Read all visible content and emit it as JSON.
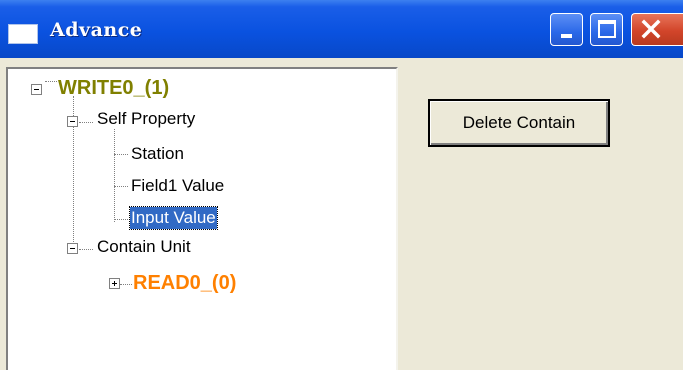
{
  "window": {
    "title": "Advance",
    "controls": [
      "minimize",
      "maximize",
      "close"
    ]
  },
  "tree": {
    "root": {
      "label": "WRITE0_(1)",
      "color": "#808000",
      "expanded": true,
      "children": [
        {
          "label": "Self Property",
          "expanded": true,
          "children": [
            {
              "label": "Station"
            },
            {
              "label": "Field1 Value"
            },
            {
              "label": "Input Value",
              "selected": true
            }
          ]
        },
        {
          "label": "Contain Unit",
          "expanded": true,
          "children": [
            {
              "label": "READ0_(0)",
              "color": "#ff8000",
              "expanded": false
            }
          ]
        }
      ]
    }
  },
  "actions": {
    "delete_contain_label": "Delete Contain"
  },
  "colors": {
    "titlebar": "#0a52e0",
    "window_bg": "#ece9d8",
    "selection": "#316ac5",
    "close_button": "#d2452a"
  }
}
